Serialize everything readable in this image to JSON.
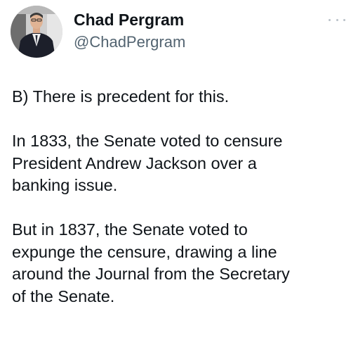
{
  "author": {
    "display_name": "Chad Pergram",
    "handle": "@ChadPergram",
    "avatar_icon": "profile-photo"
  },
  "more_icon": "ellipsis-icon",
  "tweet": {
    "paragraphs": [
      [
        "B) There is precedent for this."
      ],
      [
        "In 1833, the Senate voted to censure",
        "President Andrew Jackson over a",
        "banking issue."
      ],
      [
        "But in 1837, the Senate voted to",
        "expunge the censure, drawing a line",
        "around the Journal from the Secretary",
        "of the Senate."
      ]
    ]
  }
}
